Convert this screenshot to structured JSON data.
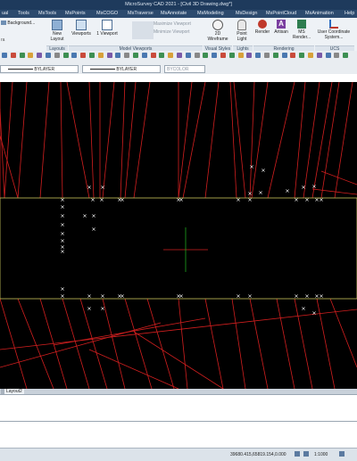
{
  "window": {
    "title": "MicroSurvey CAD 2021 - [Civil 3D Drawing.dwg*]"
  },
  "ribbon_tabs": [
    {
      "label": "ual",
      "active": false
    },
    {
      "label": "Tools",
      "active": false
    },
    {
      "label": "MsTools",
      "active": false
    },
    {
      "label": "MsPoints",
      "active": false
    },
    {
      "label": "MsCOGO",
      "active": false
    },
    {
      "label": "MsTraverse",
      "active": false
    },
    {
      "label": "MsAnnotate",
      "active": false
    },
    {
      "label": "MsModeling",
      "active": false
    },
    {
      "label": "MsDesign",
      "active": false
    },
    {
      "label": "MsPointCloud",
      "active": false
    },
    {
      "label": "MsAnimation",
      "active": false
    },
    {
      "label": "Help",
      "active": false
    }
  ],
  "ribbon": {
    "background_label": "Background...",
    "layouts_btn": "New Layout",
    "viewports_btn": "Viewports",
    "one_viewport_btn": "1 Viewport",
    "maximize_label": "Maximize Viewport",
    "minimize_label": "Minimize Viewport",
    "wireframe_btn": "2D Wireframe",
    "point_light_btn": "Point Light",
    "render_btn": "Render",
    "artisan_btn": "Artisan",
    "ms_render_btn": "MS Render...",
    "ucs_btn": "User Coordinate System...",
    "panels": {
      "layouts": "Layouts",
      "model_viewports": "Model Viewports",
      "visual_styles": "Visual Styles",
      "lights": "Lights",
      "rendering": "Rendering",
      "ucs": "UCS"
    },
    "left_partial": "ra"
  },
  "properties": {
    "linetype": "BYLAYER",
    "lineweight": "BYLAYER",
    "plotstyle": "BYCOLOR"
  },
  "layout_tabs": {
    "layout2": "Layout2"
  },
  "statusbar": {
    "coords": "39680.415,65819.154,0.000",
    "scale": "1:1000"
  },
  "colors": {
    "title_bg": "#1e3a5c",
    "canvas_bg": "#000000",
    "red_lines": "#d21f1f",
    "yellow_outline": "#c8c25a",
    "crosshair_red": "#d21f1f",
    "crosshair_green": "#1fa81f"
  }
}
